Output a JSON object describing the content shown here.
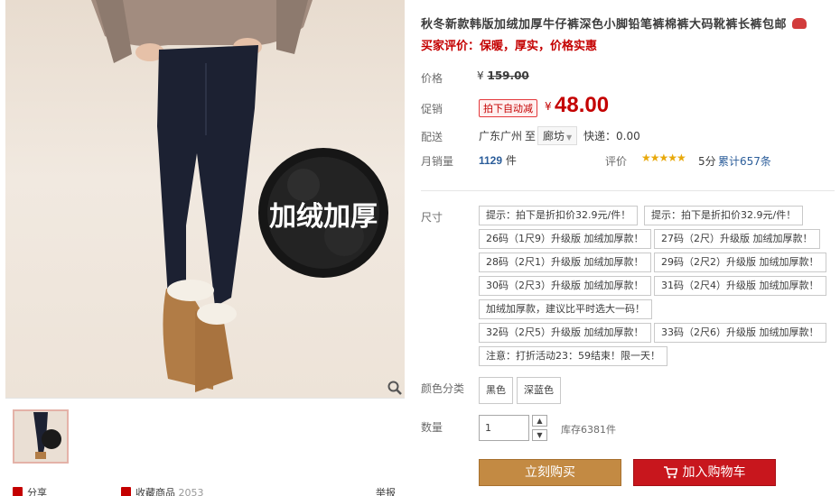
{
  "product": {
    "title": "秋冬新款韩版加绒加厚牛仔裤深色小脚铅笔裤棉裤大码靴裤长裤包邮",
    "subtitle": "买家评价：保暖，厚实，价格实惠",
    "photo_badge_text": "加绒加厚"
  },
  "price": {
    "label": "价格",
    "currency": "¥",
    "original": "159.00",
    "promo_label": "促销",
    "promo_tag": "拍下自动减",
    "promo_price": "48.00"
  },
  "delivery": {
    "label": "配送",
    "from": "广东广州",
    "to_word": "至",
    "destination": "廊坊",
    "fee": "快递：0.00"
  },
  "sales": {
    "label": "月销量",
    "count": "1129",
    "unit": "件",
    "rating_label": "评价",
    "stars": "★★★★★",
    "score": "5分",
    "review_count": "累计657条"
  },
  "options": {
    "size_label": "尺寸",
    "sizes": [
      "提示：拍下是折扣价32.9元/件！",
      "提示：拍下是折扣价32.9元/件！",
      "26码（1尺9）升级版 加绒加厚款！",
      "27码（2尺）升级版 加绒加厚款！",
      "28码（2尺1）升级版 加绒加厚款！",
      "29码（2尺2）升级版 加绒加厚款！",
      "30码（2尺3）升级版 加绒加厚款！",
      "31码（2尺4）升级版 加绒加厚款！",
      "加绒加厚款，建议比平时选大一码！",
      "32码（2尺5）升级版 加绒加厚款！",
      "33码（2尺6）升级版 加绒加厚款！",
      "注意：打折活动23：59结束！限一天！"
    ],
    "color_label": "颜色分类",
    "colors": [
      "黑色",
      "深蓝色"
    ]
  },
  "quantity": {
    "label": "数量",
    "value": "1",
    "up": "▲",
    "down": "▼",
    "stock": "库存6381件"
  },
  "actions": {
    "buy_now": "立刻购买",
    "add_to_cart": "加入购物车"
  },
  "gallery_footer": {
    "share": "分享",
    "favorite": "收藏商品",
    "favorite_count": "2053",
    "report": "举报"
  },
  "colors": {
    "accent_red": "#c40000",
    "buy_button": "#c38a43",
    "cart_button": "#c8161d",
    "link_blue": "#2b5d9a",
    "star_gold": "#e8a90c"
  }
}
